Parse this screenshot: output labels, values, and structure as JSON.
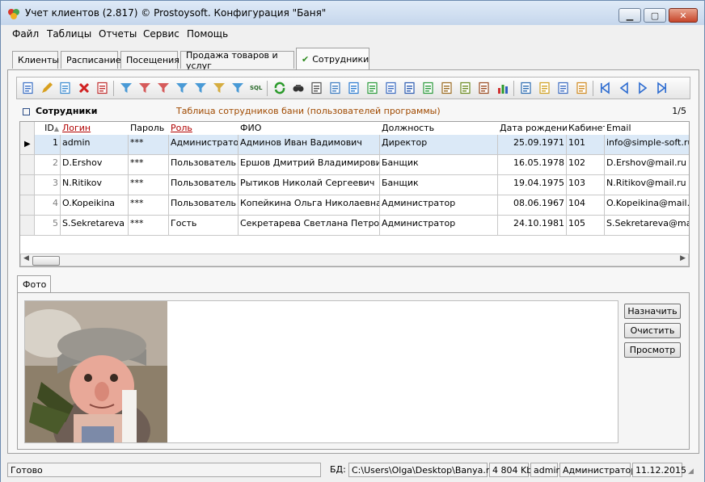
{
  "window": {
    "title": "Учет клиентов (2.817) © Prostoysoft. Конфигурация \"Баня\""
  },
  "menu": [
    "Файл",
    "Таблицы",
    "Отчеты",
    "Сервис",
    "Помощь"
  ],
  "tabs": [
    {
      "label": "Клиенты",
      "active": false
    },
    {
      "label": "Расписание",
      "active": false
    },
    {
      "label": "Посещения",
      "active": false
    },
    {
      "label": "Продажа товаров и услуг",
      "active": false
    },
    {
      "label": "Сотрудники",
      "active": true,
      "check": "✔"
    }
  ],
  "toolbar_icons": [
    "new-record-icon",
    "edit-icon",
    "copy-icon",
    "delete-icon",
    "delete-all-icon",
    "filter-icon",
    "filter-remove-icon",
    "filter-clear-icon",
    "filter-advanced-icon",
    "filter-grid-icon",
    "filter-funnel-icon",
    "filter-tree-icon",
    "sql-icon",
    "refresh-icon",
    "find-icon",
    "print-icon",
    "preview-icon",
    "export-html-icon",
    "export-excel-icon",
    "export-xml-icon",
    "export-word-icon",
    "export-xls-icon",
    "export-txt-icon",
    "export-csv-icon",
    "export-other-icon",
    "chart-icon",
    "import-icon",
    "import-list-icon",
    "grid-settings-icon",
    "grid-columns-icon",
    "first-record-icon",
    "prev-record-icon",
    "next-record-icon",
    "last-record-icon"
  ],
  "grid": {
    "title": "Сотрудники",
    "description": "Таблица сотрудников бани (пользователей программы)",
    "counter": "1/5",
    "sort_arrow": "▲",
    "columns": [
      "ID",
      "Логин",
      "Пароль",
      "Роль",
      "ФИО",
      "Должность",
      "Дата рождения",
      "Кабинет",
      "Email"
    ],
    "rows": [
      [
        "1",
        "admin",
        "***",
        "Администратор",
        "Админов Иван Вадимович",
        "Директор",
        "25.09.1971",
        "101",
        "info@simple-soft.ru"
      ],
      [
        "2",
        "D.Ershov",
        "***",
        "Пользователь",
        "Ершов Дмитрий Владимирович",
        "Банщик",
        "16.05.1978",
        "102",
        "D.Ershov@mail.ru"
      ],
      [
        "3",
        "N.Ritikov",
        "***",
        "Пользователь",
        "Рытиков Николай Сергеевич",
        "Банщик",
        "19.04.1975",
        "103",
        "N.Ritikov@mail.ru"
      ],
      [
        "4",
        "O.Kopeikina",
        "***",
        "Пользователь",
        "Копейкина Ольга Николаевна",
        "Администратор",
        "08.06.1967",
        "104",
        "O.Kopeikina@mail.ru"
      ],
      [
        "5",
        "S.Sekretareva",
        "***",
        "Гость",
        "Секретарева Светлана Петровна",
        "Администратор",
        "24.10.1981",
        "105",
        "S.Sekretareva@mail.ru"
      ]
    ],
    "selected_row": 0
  },
  "photo": {
    "tab_label": "Фото",
    "assign_label": "Назначить",
    "clear_label": "Очистить",
    "view_label": "Просмотр"
  },
  "status": {
    "ready": "Готово",
    "db_label": "БД:",
    "db_path": "C:\\Users\\Olga\\Desktop\\Banya.mdb",
    "db_size": "4 804 Kb",
    "user": "admin",
    "role": "Администратор",
    "date": "11.12.2015"
  },
  "colors": {
    "accent": "#b00000",
    "selection": "#dbe9f7",
    "description": "#a04a00"
  }
}
